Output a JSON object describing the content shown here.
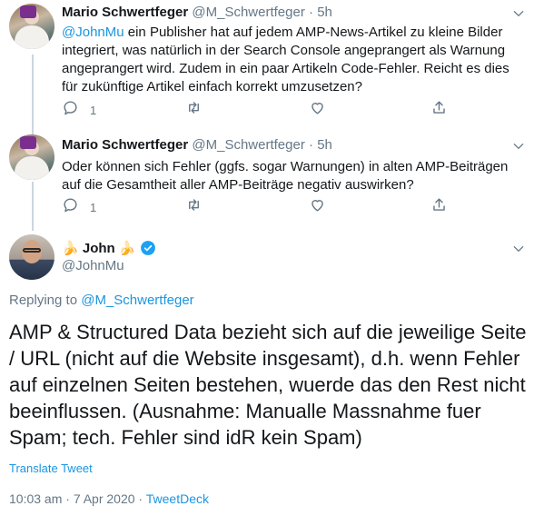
{
  "tweets": [
    {
      "name": "Mario Schwertfeger",
      "handle": "@M_Schwertfeger",
      "separator": "·",
      "time": "5h",
      "mention": "@JohnMu",
      "text": " ein Publisher hat auf jedem AMP-News-Artikel zu kleine Bilder integriert, was natürlich in der Search Console angeprangert als Warnung angeprangert wird. Zudem in ein paar Artikeln Code-Fehler. Reicht es dies für zukünftige Artikel einfach korrekt umzusetzen?",
      "reply_count": "1"
    },
    {
      "name": "Mario Schwertfeger",
      "handle": "@M_Schwertfeger",
      "separator": "·",
      "time": "5h",
      "text": "Oder können sich Fehler (ggfs. sogar Warnungen) in alten AMP-Beiträgen auf die Gesamtheit aller AMP-Beiträge negativ auswirken?",
      "reply_count": "1"
    }
  ],
  "main_tweet": {
    "name_prefix_emoji": "🍌",
    "name": "John",
    "name_suffix_emoji": "🍌",
    "handle": "@JohnMu",
    "replying_label": "Replying to",
    "replying_to": "@M_Schwertfeger",
    "text": "AMP & Structured Data bezieht sich auf die jeweilige Seite / URL (nicht auf die Website insgesamt), d.h. wenn Fehler auf einzelnen Seiten bestehen, wuerde das den Rest nicht beeinflussen. (Ausnahme: Manualle Massnahme fuer Spam; tech. Fehler sind idR kein Spam)",
    "translate_label": "Translate Tweet",
    "timestamp": "10:03 am · 7 Apr 2020 ·",
    "source": "TweetDeck"
  },
  "icons": [
    "reply-icon",
    "retweet-icon",
    "like-icon",
    "share-icon",
    "caret-down-icon",
    "verified-badge-icon"
  ],
  "colors": {
    "text": "#14171a",
    "muted": "#657786",
    "link": "#1b95e0",
    "thread_line": "#ccd6dd",
    "verified": "#1da1f2"
  }
}
